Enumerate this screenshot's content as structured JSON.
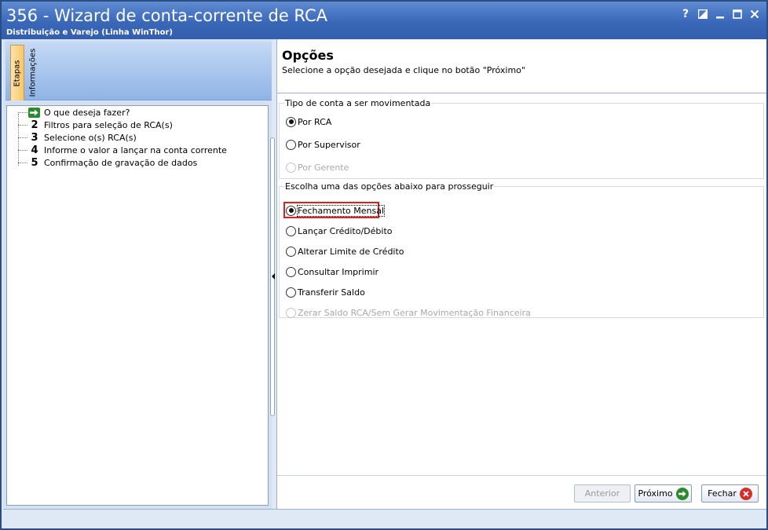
{
  "window": {
    "title": "356 - Wizard de conta-corrente de RCA",
    "subtitle": "Distribuição e Varejo (Linha WinThor)",
    "controls": {
      "help": "?",
      "restore_icon": "restore-icon",
      "maximize_icon": "maximize-icon",
      "close_icon": "close-icon"
    }
  },
  "left": {
    "tabs": [
      {
        "label": "Etapas",
        "active": true
      },
      {
        "label": "Informações",
        "active": false
      }
    ],
    "steps": [
      {
        "marker": "arrow",
        "label": "O que deseja fazer?"
      },
      {
        "marker": "2",
        "label": "Filtros para seleção de RCA(s)"
      },
      {
        "marker": "3",
        "label": "Selecione o(s) RCA(s)"
      },
      {
        "marker": "4",
        "label": "Informe o valor a lançar na conta corrente"
      },
      {
        "marker": "5",
        "label": "Confirmação de gravação de dados"
      }
    ]
  },
  "right": {
    "title": "Opções",
    "subtitle": "Selecione a opção desejada e clique no botão \"Próximo\"",
    "group1": {
      "legend": "Tipo de conta a ser movimentada",
      "options": [
        {
          "label": "Por RCA",
          "checked": true,
          "disabled": false
        },
        {
          "label": "Por Supervisor",
          "checked": false,
          "disabled": false
        },
        {
          "label": "Por Gerente",
          "checked": false,
          "disabled": true
        }
      ]
    },
    "group2": {
      "legend": "Escolha uma das opções abaixo para prosseguir",
      "options": [
        {
          "label": "Fechamento Mensal",
          "checked": true,
          "disabled": false
        },
        {
          "label": "Lançar Crédito/Débito",
          "checked": false,
          "disabled": false
        },
        {
          "label": "Alterar Limite de Crédito",
          "checked": false,
          "disabled": false
        },
        {
          "label": "Consultar Imprimir",
          "checked": false,
          "disabled": false
        },
        {
          "label": "Transferir Saldo",
          "checked": false,
          "disabled": false
        },
        {
          "label": "Zerar Saldo RCA/Sem Gerar Movimentação Financeira",
          "checked": false,
          "disabled": true
        }
      ]
    }
  },
  "buttons": {
    "anterior": {
      "label": "Anterior",
      "enabled": false
    },
    "proximo": {
      "label": "Próximo",
      "enabled": true,
      "icon": "next-arrow-icon"
    },
    "fechar": {
      "label": "Fechar",
      "enabled": true,
      "icon": "close-icon"
    }
  },
  "colors": {
    "titlebar": "#3a67b8",
    "highlight": "#e0201f",
    "next_icon": "#2c8a2c",
    "close_icon": "#d3302c"
  }
}
